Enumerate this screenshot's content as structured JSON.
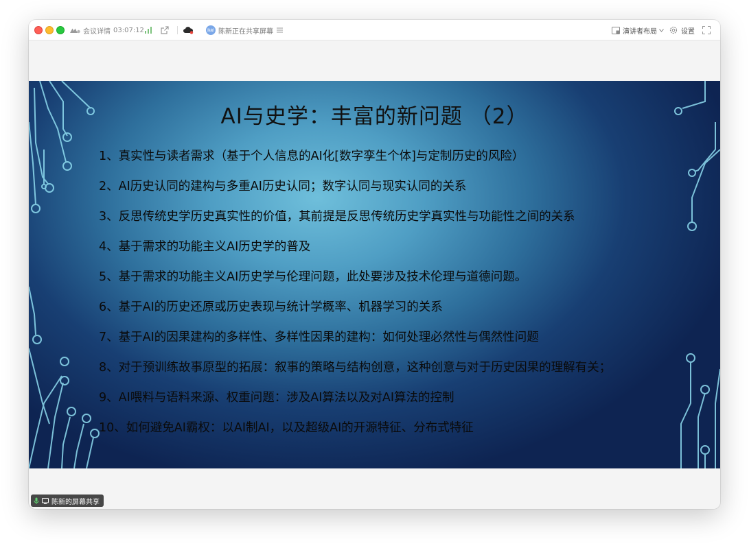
{
  "titlebar": {
    "meeting_details": "会议详情",
    "timer": "03:07:12",
    "sharing_status": "陈新正在共享屏幕",
    "presenter_layout": "演讲者布局",
    "settings": "设置",
    "avatar_initials": "陈新"
  },
  "slide": {
    "title": "AI与史学：丰富的新问题 （2）",
    "items": [
      "1、真实性与读者需求（基于个人信息的AI化[数字孪生个体]与定制历史的风险）",
      "2、AI历史认同的建构与多重AI历史认同；数字认同与现实认同的关系",
      "3、反思传统史学历史真实性的价值，其前提是反思传统历史学真实性与功能性之间的关系",
      "4、基于需求的功能主义AI历史学的普及",
      "5、基于需求的功能主义AI历史学与伦理问题，此处要涉及技术伦理与道德问题。",
      "6、基于AI的历史还原或历史表现与统计学概率、机器学习的关系",
      "7、基于AI的因果建构的多样性、多样性因果的建构：如何处理必然性与偶然性问题",
      "8、对于预训练故事原型的拓展：叙事的策略与结构创意，这种创意与对于历史因果的理解有关；",
      "9、AI喂料与语料来源、权重问题：涉及AI算法以及对AI算法的控制",
      "10、如何避免AI霸权：以AI制AI，以及超级AI的开源特征、分布式特征"
    ]
  },
  "share_badge": "陈新的屏幕共享",
  "colors": {
    "accent_blue": "#4a90e2",
    "slide_line": "#8fdcf0",
    "close_red": "#fe5f57",
    "minimize_yellow": "#febc2e",
    "zoom_green": "#28c840"
  }
}
